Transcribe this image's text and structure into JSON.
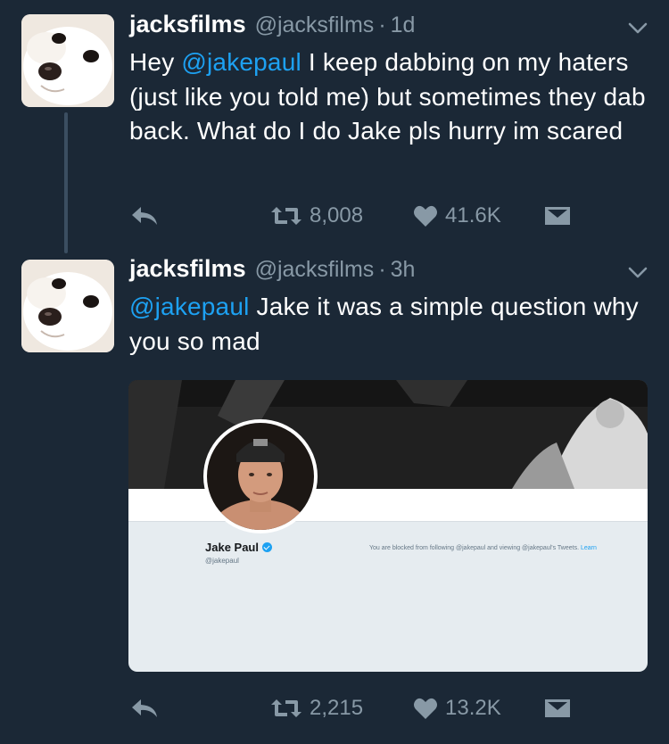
{
  "tweets": [
    {
      "display_name": "jacksfilms",
      "handle": "@jacksfilms",
      "separator": "·",
      "time": "1d",
      "text_parts": [
        "Hey ",
        "@jakepaul",
        " I keep dabbing on my haters (just like you told me) but sometimes they dab back. What do I do Jake pls hurry im scared"
      ],
      "retweets": "8,008",
      "likes": "41.6K"
    },
    {
      "display_name": "jacksfilms",
      "handle": "@jacksfilms",
      "separator": "·",
      "time": "3h",
      "text_parts": [
        "@jakepaul",
        " Jake it was a simple question why you so mad"
      ],
      "retweets": "2,215",
      "likes": "13.2K",
      "media": {
        "profile_name": "Jake Paul",
        "profile_handle": "@jakepaul",
        "blocked_text": "You are blocked from following @jakepaul and viewing @jakepaul's Tweets.",
        "learn_more": "Learn"
      }
    }
  ],
  "colors": {
    "background": "#1b2836",
    "secondary_text": "#8899a6",
    "mention": "#1da1f2",
    "thread_line": "#3b4e61"
  },
  "icons": [
    "reply-icon",
    "retweet-icon",
    "like-icon",
    "direct-message-icon",
    "chevron-down-icon",
    "verified-icon"
  ]
}
